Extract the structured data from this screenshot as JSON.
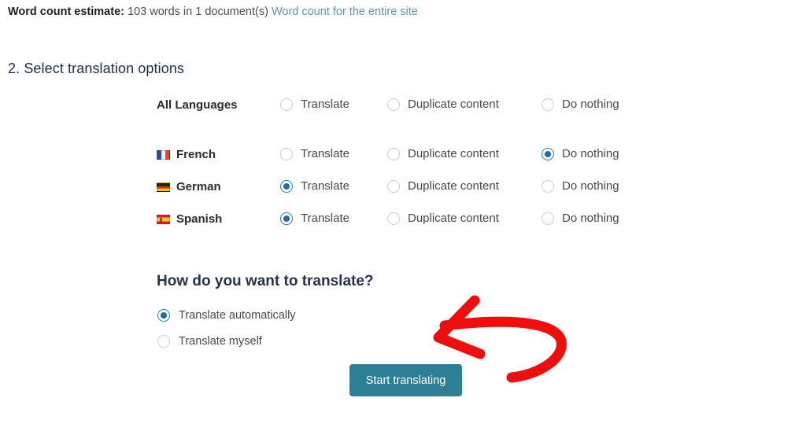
{
  "word_count": {
    "label": "Word count estimate:",
    "value": "103 words in 1 document(s)",
    "link": "Word count for the entire site"
  },
  "section": {
    "heading": "2. Select translation options"
  },
  "columns": [
    {
      "key": "translate",
      "label": "Translate"
    },
    {
      "key": "duplicate",
      "label": "Duplicate content"
    },
    {
      "key": "nothing",
      "label": "Do nothing"
    }
  ],
  "languages": [
    {
      "name": "All Languages",
      "flag": "",
      "selected": "",
      "options": [
        "Translate",
        "Duplicate content",
        "Do nothing"
      ]
    },
    {
      "name": "French",
      "flag": "flag-france-icon",
      "selected": "nothing",
      "options": [
        "Translate",
        "Duplicate content",
        "Do nothing"
      ]
    },
    {
      "name": "German",
      "flag": "flag-germany-icon",
      "selected": "translate",
      "options": [
        "Translate",
        "Duplicate content",
        "Do nothing"
      ]
    },
    {
      "name": "Spanish",
      "flag": "flag-spain-icon",
      "selected": "translate",
      "options": [
        "Translate",
        "Duplicate content",
        "Do nothing"
      ]
    }
  ],
  "how_to": {
    "heading": "How do you want to translate?",
    "options": [
      {
        "label": "Translate automatically",
        "selected": true
      },
      {
        "label": "Translate myself",
        "selected": false
      }
    ]
  },
  "action": {
    "start_label": "Start translating"
  },
  "annotation": {
    "arrow": "red-arrow-annotation",
    "color": "#f20d0d"
  },
  "colors": {
    "accent_radio": "#1b6fa8",
    "button_bg": "#2d7f96",
    "link": "#5d93bd",
    "heading": "#1b2f4b"
  }
}
